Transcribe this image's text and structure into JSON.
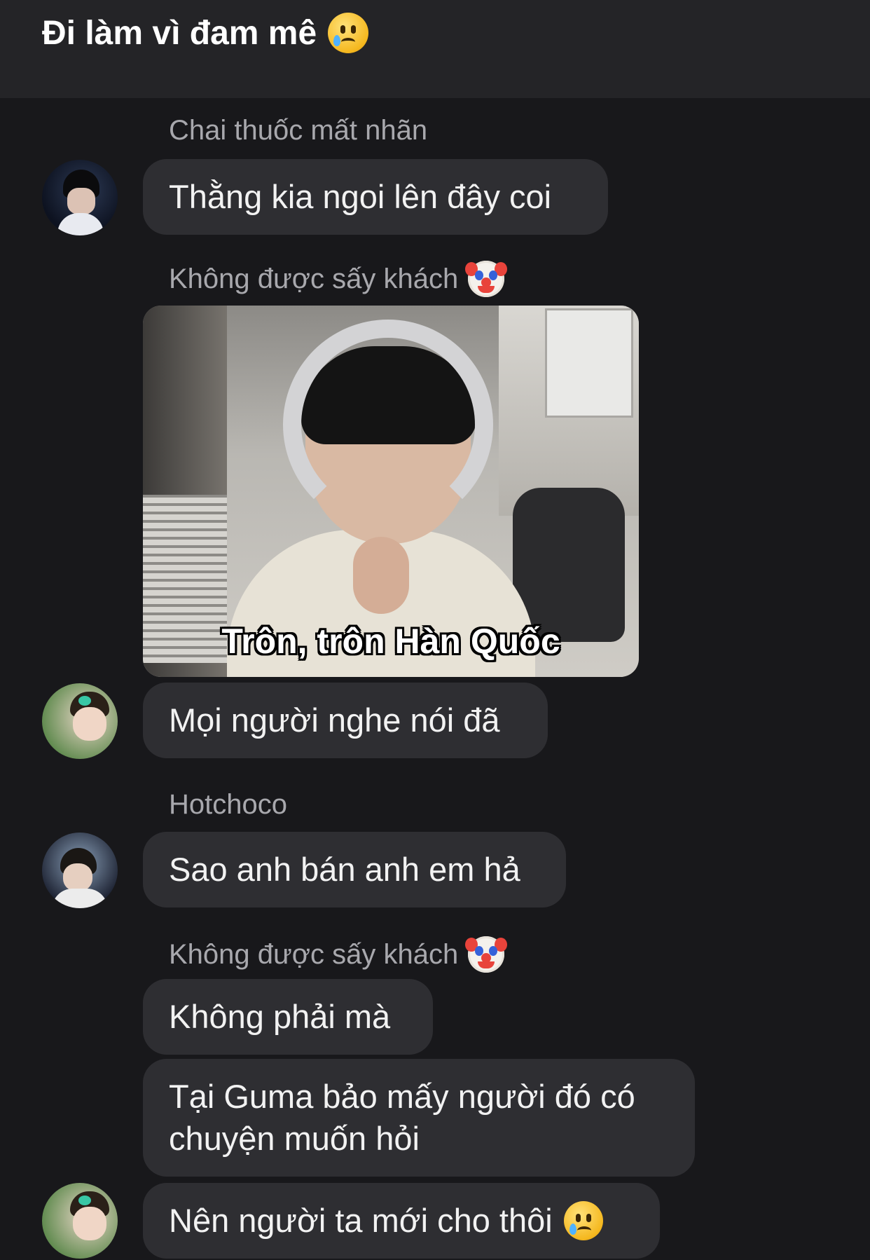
{
  "header": {
    "title": "Đi làm vì đam mê",
    "title_emoji": "crying-face-emoji"
  },
  "messages": [
    {
      "sender": "Chai thuốc mất nhãn",
      "text": "Thằng kia ngoi lên đây coi"
    },
    {
      "sender": "Không được sấy khách",
      "sender_emoji": "clown-face-emoji",
      "image_caption": "Trôn, trôn Hàn Quốc",
      "text": "Mọi người nghe nói đã"
    },
    {
      "sender": "Hotchoco",
      "text": "Sao anh bán anh em hả"
    },
    {
      "sender": "Không được sấy khách",
      "sender_emoji": "clown-face-emoji",
      "texts": [
        "Không phải mà",
        "Tại Guma bảo mấy người đó có chuyện muốn hỏi",
        "Nên người ta mới cho thôi"
      ],
      "last_emoji": "crying-face-emoji"
    }
  ],
  "colors": {
    "background": "#18181b",
    "header": "#242427",
    "bubble": "#2e2e32",
    "sender_text": "#a8a8ad",
    "message_text": "#f2f2f2"
  }
}
